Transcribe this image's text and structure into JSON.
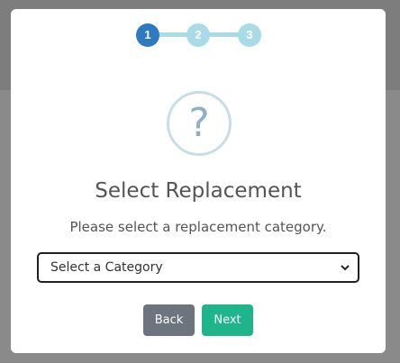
{
  "stepper": {
    "steps": [
      "1",
      "2",
      "3"
    ],
    "active_step": 1,
    "colors": {
      "active": "#2d79c2",
      "inactive": "#a8dbe5"
    }
  },
  "dialog": {
    "icon": "question-circle-icon",
    "title": "Select Replacement",
    "subtitle": "Please select a replacement category.",
    "category_select": {
      "selected": "Select a Category"
    },
    "buttons": {
      "back": "Back",
      "next": "Next"
    },
    "colors": {
      "back": "#6c757d",
      "next": "#1fb58a"
    }
  }
}
